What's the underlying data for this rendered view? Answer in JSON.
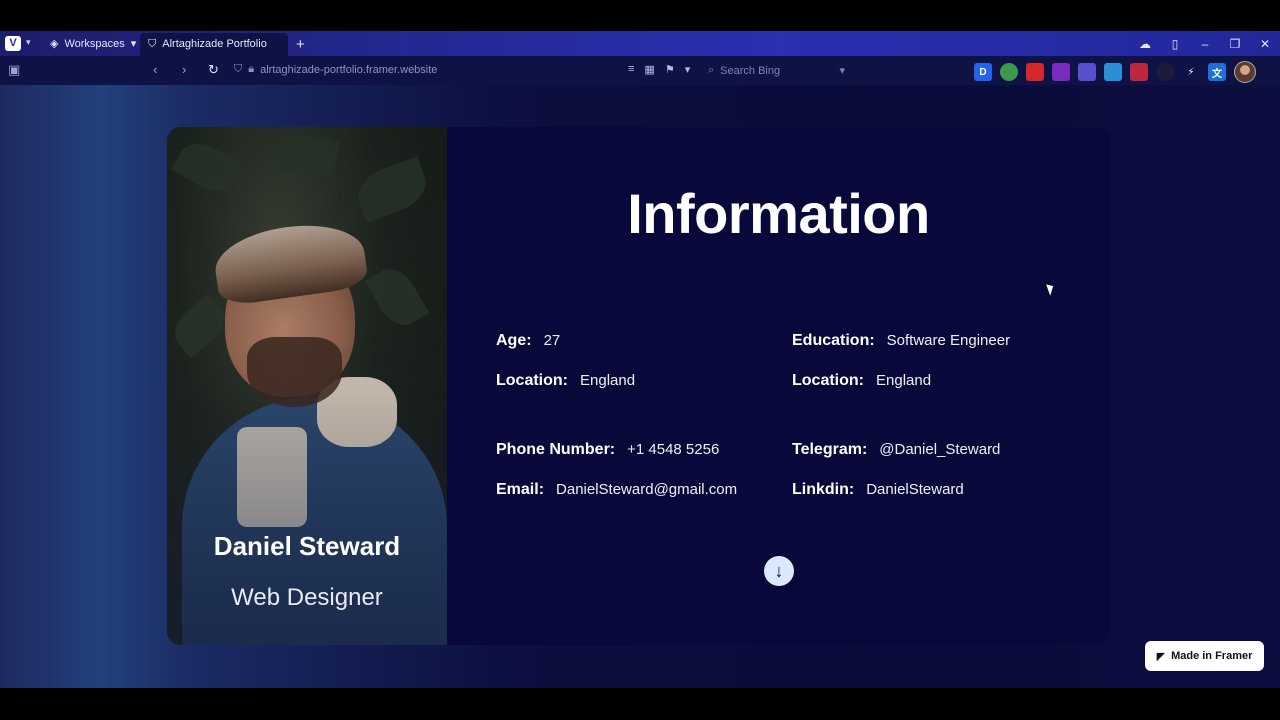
{
  "browser": {
    "workspaces_label": "Workspaces",
    "active_tab_title": "Alrtaghizade Portfolio",
    "new_tab_symbol": "+",
    "url": "alrtaghizade-portfolio.framer.website",
    "search_placeholder": "Search Bing",
    "ext_d_label": "D"
  },
  "profile": {
    "name": "Daniel Steward",
    "role": "Web Designer"
  },
  "info": {
    "title": "Information",
    "left": [
      {
        "key": "Age:",
        "value": "27"
      },
      {
        "key": "Location:",
        "value": "England"
      },
      {
        "key": "Phone Number:",
        "value": "+1 4548 5256"
      },
      {
        "key": "Email:",
        "value": "DanielSteward@gmail.com"
      }
    ],
    "right": [
      {
        "key": "Education:",
        "value": "Software Engineer"
      },
      {
        "key": "Location:",
        "value": "England"
      },
      {
        "key": "Telegram:",
        "value": "@Daniel_Steward"
      },
      {
        "key": "Linkdin:",
        "value": "DanielSteward"
      }
    ]
  },
  "badge": {
    "label": "Made in Framer"
  },
  "colors": {
    "page_bg": "#0a0b3a",
    "accent_button": "#dbe8ff"
  }
}
